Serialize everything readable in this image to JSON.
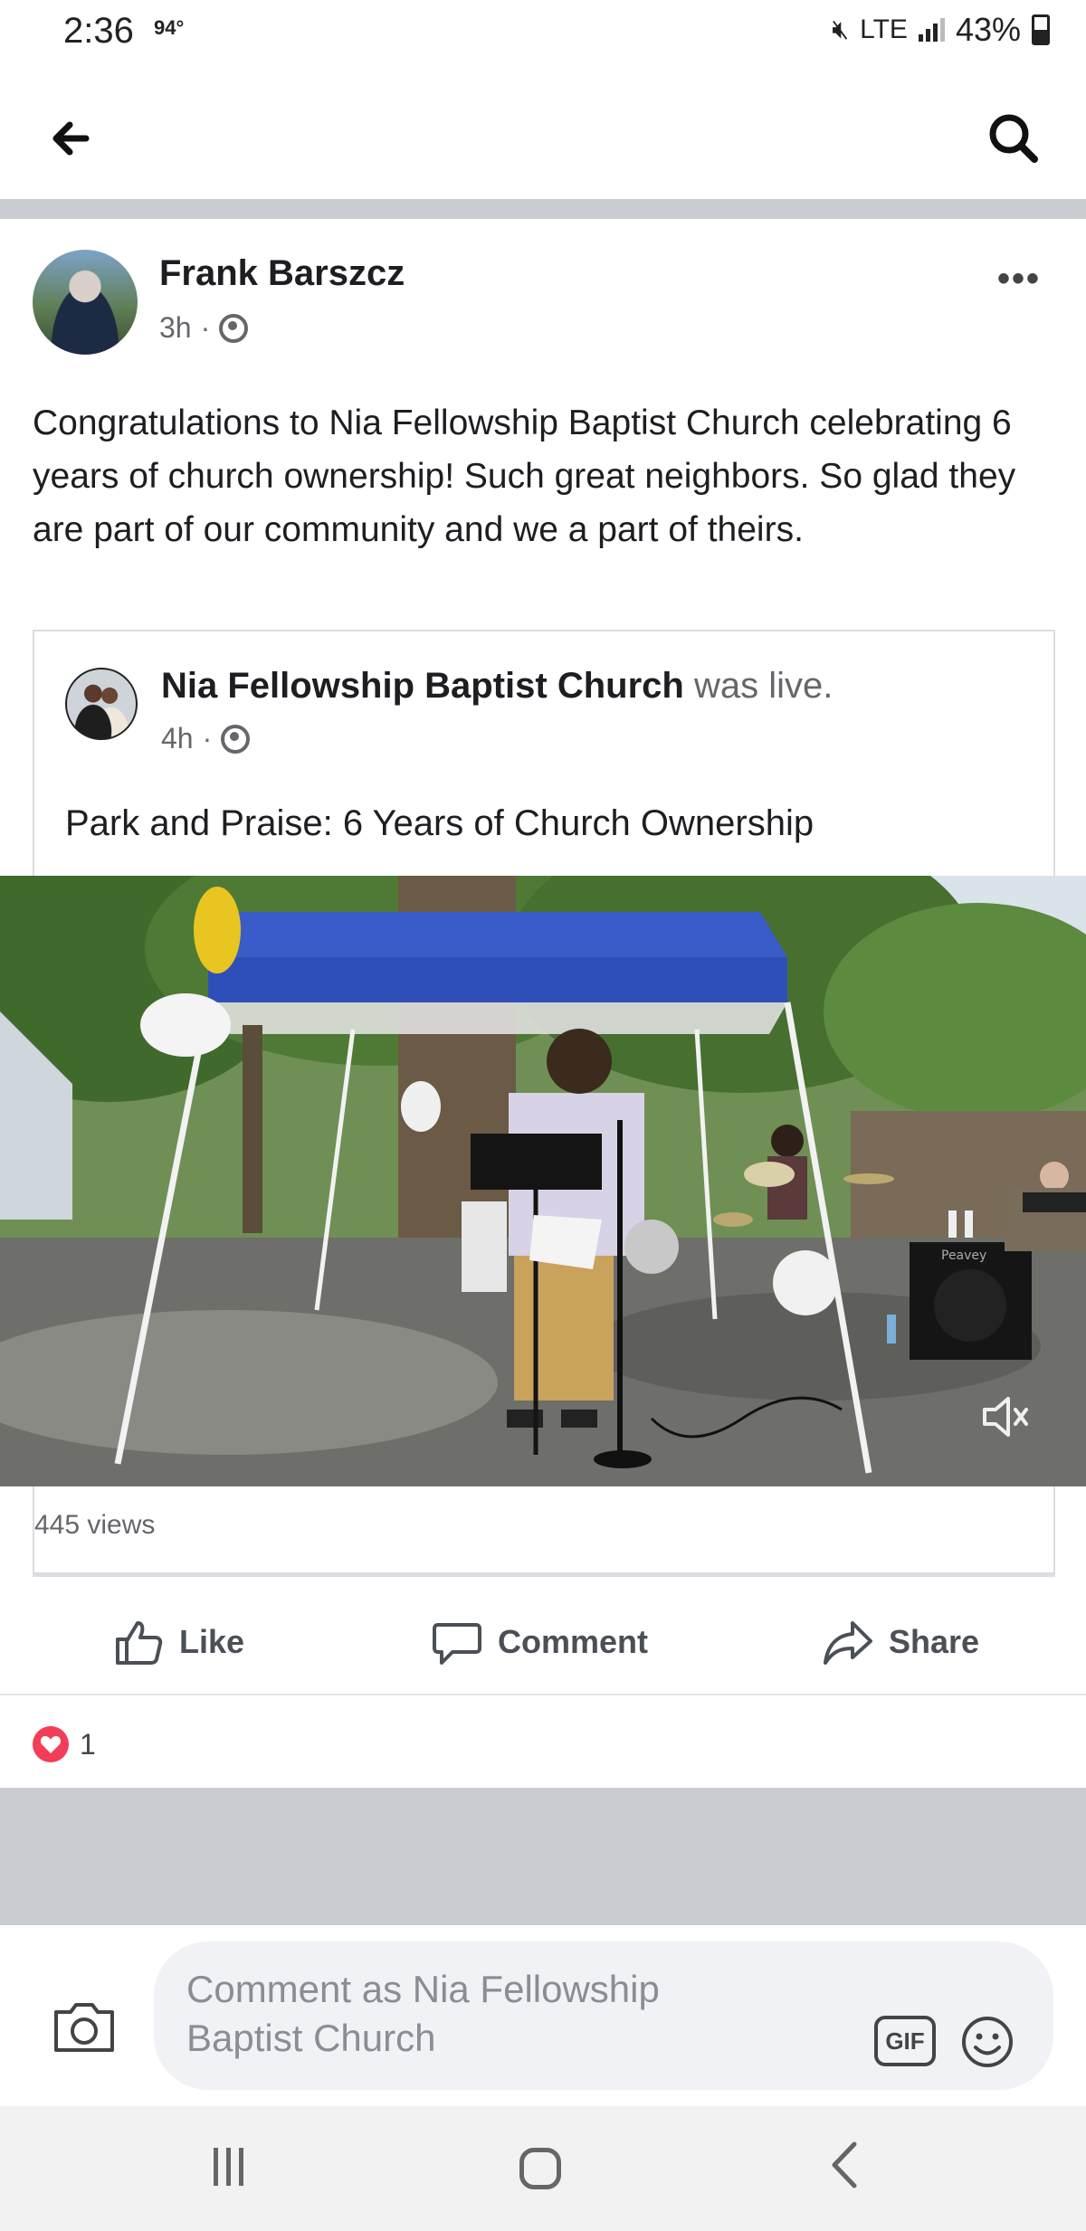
{
  "status_bar": {
    "time": "2:36",
    "temperature": "94°",
    "network": "LTE",
    "battery": "43%"
  },
  "post": {
    "author": "Frank Barszcz",
    "time_ago": "3h",
    "text": "Congratulations to Nia Fellowship Baptist Church celebrating 6 years of church ownership! Such great neighbors. So glad they are part of our community and we a part of theirs."
  },
  "shared": {
    "page_name": "Nia Fellowship Baptist Church",
    "status_suffix": "was live.",
    "time_ago": "4h",
    "description": "Park and Praise: 6 Years of Church Ownership"
  },
  "video": {
    "views": "445 views",
    "speaker_stand_logo": "Peavey"
  },
  "actions": {
    "like": "Like",
    "comment": "Comment",
    "share": "Share"
  },
  "reactions": {
    "count": "1"
  },
  "composer": {
    "placeholder": "Comment as Nia Fellowship Baptist Church",
    "gif": "GIF"
  },
  "colors": {
    "tent_blue": "#2f4fb8",
    "reaction_red": "#f33e58",
    "separator_gray": "#c9ccd1"
  }
}
